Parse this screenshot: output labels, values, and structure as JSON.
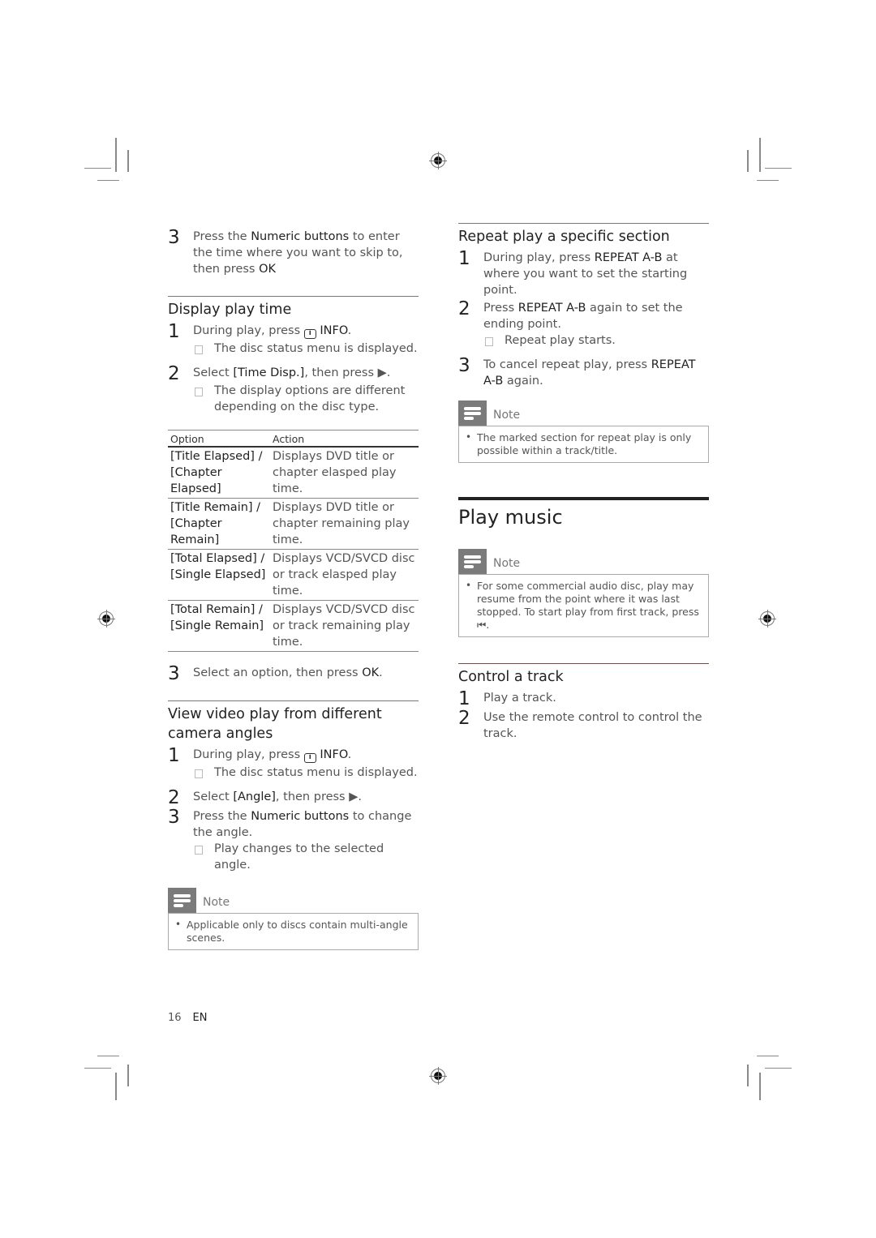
{
  "left_column": {
    "intro_step": {
      "number": "3",
      "parts": [
        "Press the ",
        "Numeric buttons",
        " to enter the time where you want to skip to, then press ",
        "OK"
      ]
    },
    "display_play_time": {
      "heading": "Display play time",
      "step1": {
        "number": "1",
        "pre": "During play, press ",
        "icon": "info-icon",
        "icon_glyph": "i",
        "key": "INFO",
        "post": ".",
        "result": "The disc status menu is displayed."
      },
      "step2": {
        "number": "2",
        "pre": "Select ",
        "key": "[Time Disp.]",
        "post": ", then press ▶.",
        "result": "The display options are different depending on the disc type."
      },
      "table": {
        "headers": [
          "Option",
          "Action"
        ],
        "rows": [
          {
            "option": "[Title Elapsed] / [Chapter Elapsed]",
            "action": "Displays DVD title or chapter elasped play time."
          },
          {
            "option": "[Title Remain] / [Chapter Remain]",
            "action": "Displays DVD title or chapter remaining play time."
          },
          {
            "option": "[Total Elapsed] / [Single Elapsed]",
            "action": "Displays VCD/SVCD disc or track elasped play time."
          },
          {
            "option": "[Total Remain] / [Single Remain]",
            "action": "Displays VCD/SVCD disc or track remaining play time."
          }
        ]
      },
      "step3": {
        "number": "3",
        "pre": "Select an option, then press ",
        "key": "OK",
        "post": "."
      }
    },
    "camera_angles": {
      "heading": "View video play from different camera angles",
      "step1": {
        "number": "1",
        "pre": "During play, press ",
        "icon_glyph": "i",
        "key": "INFO",
        "post": ".",
        "result": "The disc status menu is displayed."
      },
      "step2": {
        "number": "2",
        "pre": "Select ",
        "key": "[Angle]",
        "post": ", then press ▶."
      },
      "step3": {
        "number": "3",
        "pre": "Press the ",
        "key": "Numeric buttons",
        "post": " to change the angle.",
        "result": "Play changes to the selected angle."
      },
      "note": {
        "label": "Note",
        "bullet": "•",
        "text": "Applicable only to discs contain multi-angle scenes."
      }
    }
  },
  "right_column": {
    "repeat_section": {
      "heading": "Repeat play a specific section",
      "step1": {
        "number": "1",
        "pre": "During play, press ",
        "key": "REPEAT A-B",
        "post": " at where you want to set the starting point."
      },
      "step2": {
        "number": "2",
        "pre": "Press ",
        "key": "REPEAT A-B",
        "post": " again to set the ending point.",
        "result": "Repeat play starts."
      },
      "step3": {
        "number": "3",
        "pre": "To cancel repeat play, press ",
        "key": "REPEAT A-B",
        "post": " again."
      },
      "note": {
        "label": "Note",
        "bullet": "•",
        "text": "The marked section for repeat play is only possible within a track/title."
      }
    },
    "play_music": {
      "heading": "Play music",
      "note": {
        "label": "Note",
        "bullet": "•",
        "text": "For some commercial audio disc, play may resume from the point where it was last stopped. To start play from first track, press ⏮."
      }
    },
    "control_track": {
      "heading": "Control a track",
      "step1": {
        "number": "1",
        "text": "Play a track."
      },
      "step2": {
        "number": "2",
        "text": "Use the remote control to control the track."
      }
    }
  },
  "footer": {
    "page_number": "16",
    "language": "EN"
  }
}
